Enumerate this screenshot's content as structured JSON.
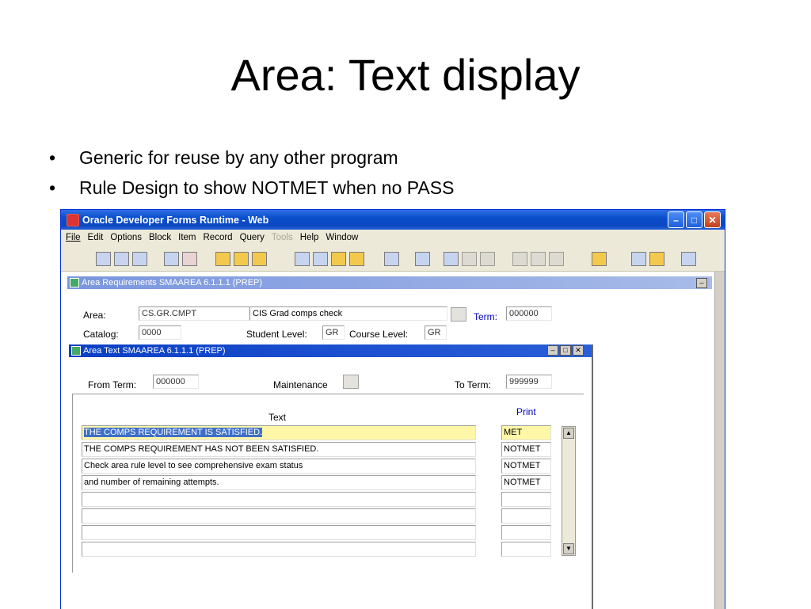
{
  "slide": {
    "title": "Area: Text display",
    "bullets": [
      "Generic for reuse by any other program",
      "Rule Design to show NOTMET when no PASS"
    ]
  },
  "window": {
    "title": "Oracle Developer Forms Runtime - Web",
    "menu": [
      {
        "label": "File",
        "enabled": true
      },
      {
        "label": "Edit",
        "enabled": true
      },
      {
        "label": "Options",
        "enabled": true
      },
      {
        "label": "Block",
        "enabled": true
      },
      {
        "label": "Item",
        "enabled": true
      },
      {
        "label": "Record",
        "enabled": true
      },
      {
        "label": "Query",
        "enabled": true
      },
      {
        "label": "Tools",
        "enabled": false
      },
      {
        "label": "Help",
        "enabled": true
      },
      {
        "label": "Window",
        "enabled": true
      }
    ]
  },
  "area_req": {
    "title": "Area Requirements  SMAAREA  6.1.1.1  (PREP)",
    "area_label": "Area:",
    "area_code": "CS.GR.CMPT",
    "area_desc": "CIS Grad comps check",
    "term_label": "Term:",
    "term_value": "000000",
    "catalog_label": "Catalog:",
    "catalog_value": "0000",
    "student_level_label": "Student Level:",
    "student_level_value": "GR",
    "course_level_label": "Course Level:",
    "course_level_value": "GR"
  },
  "area_text": {
    "title": "Area Text  SMAAREA  6.1.1.1  (PREP)",
    "from_term_label": "From Term:",
    "from_term_value": "000000",
    "maintenance_label": "Maintenance",
    "to_term_label": "To Term:",
    "to_term_value": "999999",
    "text_header": "Text",
    "print_header": "Print",
    "rows": [
      {
        "text": "THE COMPS REQUIREMENT IS SATISFIED.",
        "print": "MET"
      },
      {
        "text": "THE COMPS REQUIREMENT HAS NOT BEEN SATISFIED.",
        "print": "NOTMET"
      },
      {
        "text": "Check area rule level to see comprehensive exam status",
        "print": "NOTMET"
      },
      {
        "text": "and number of remaining attempts.",
        "print": "NOTMET"
      },
      {
        "text": "",
        "print": ""
      },
      {
        "text": "",
        "print": ""
      },
      {
        "text": "",
        "print": ""
      },
      {
        "text": "",
        "print": ""
      }
    ]
  }
}
